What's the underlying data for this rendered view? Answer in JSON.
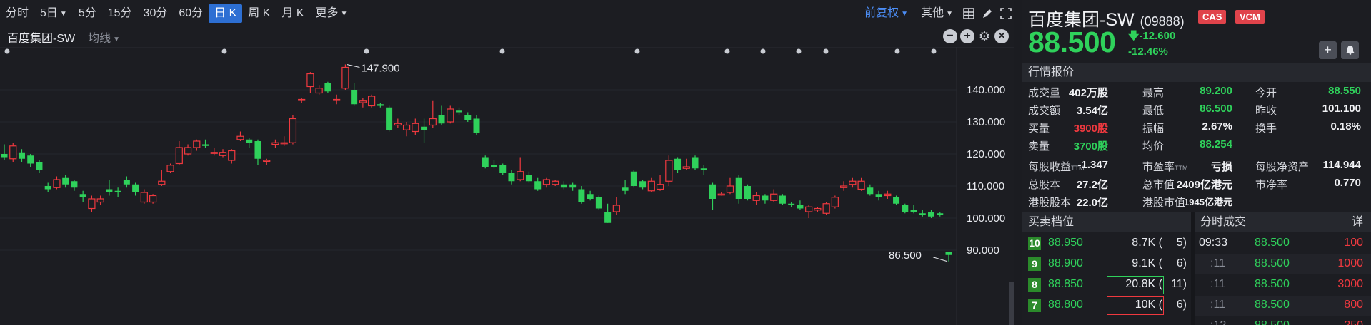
{
  "toolbar": {
    "periods": [
      "分时",
      "5日",
      "5分",
      "15分",
      "30分",
      "60分",
      "日 K",
      "周 K",
      "月 K",
      "更多"
    ],
    "active_period": "日 K",
    "adjust": "前复权",
    "other": "其他"
  },
  "chart_header": {
    "name": "百度集团-SW",
    "ma": "均线"
  },
  "chart_data": {
    "type": "candlestick",
    "y_ticks": [
      "140.000",
      "130.000",
      "120.000",
      "110.000",
      "100.000",
      "90.000"
    ],
    "ylim": [
      86,
      150
    ],
    "high_label": "147.900",
    "low_label": "86.500",
    "up_color": "#f0393f",
    "down_color": "#2fd15b",
    "candles": [
      {
        "o": 120.0,
        "c": 119.0,
        "h": 123.0,
        "l": 118.0
      },
      {
        "o": 118.5,
        "c": 122.5,
        "h": 123.5,
        "l": 117.5
      },
      {
        "o": 120.5,
        "c": 118.5,
        "h": 121.5,
        "l": 117.5
      },
      {
        "o": 119.5,
        "c": 117.0,
        "h": 120.0,
        "l": 116.0
      },
      {
        "o": 117.5,
        "c": 115.0,
        "h": 118.0,
        "l": 114.0
      },
      {
        "o": 110.0,
        "c": 109.0,
        "h": 111.0,
        "l": 108.0
      },
      {
        "o": 109.5,
        "c": 112.0,
        "h": 113.0,
        "l": 109.0
      },
      {
        "o": 112.5,
        "c": 110.5,
        "h": 113.5,
        "l": 109.5
      },
      {
        "o": 111.5,
        "c": 109.5,
        "h": 112.0,
        "l": 108.5
      },
      {
        "o": 107.5,
        "c": 106.5,
        "h": 108.5,
        "l": 105.0
      },
      {
        "o": 103.0,
        "c": 106.0,
        "h": 107.0,
        "l": 102.0
      },
      {
        "o": 105.0,
        "c": 106.0,
        "h": 107.0,
        "l": 104.0
      },
      {
        "o": 109.0,
        "c": 108.0,
        "h": 112.0,
        "l": 107.0
      },
      {
        "o": 108.5,
        "c": 108.0,
        "h": 109.5,
        "l": 106.5
      },
      {
        "o": 112.0,
        "c": 110.5,
        "h": 113.0,
        "l": 109.5
      },
      {
        "o": 110.5,
        "c": 108.0,
        "h": 111.0,
        "l": 107.0
      },
      {
        "o": 105.0,
        "c": 108.0,
        "h": 109.0,
        "l": 104.5
      },
      {
        "o": 105.0,
        "c": 107.0,
        "h": 107.5,
        "l": 104.5
      },
      {
        "o": 110.5,
        "c": 111.5,
        "h": 115.0,
        "l": 110.0
      },
      {
        "o": 114.5,
        "c": 116.5,
        "h": 117.0,
        "l": 114.0
      },
      {
        "o": 117.0,
        "c": 122.0,
        "h": 124.0,
        "l": 116.5
      },
      {
        "o": 120.0,
        "c": 122.0,
        "h": 123.0,
        "l": 119.5
      },
      {
        "o": 122.0,
        "c": 124.0,
        "h": 124.5,
        "l": 121.0
      },
      {
        "o": 123.0,
        "c": 122.5,
        "h": 124.5,
        "l": 122.0
      },
      {
        "o": 120.5,
        "c": 120.5,
        "h": 122.0,
        "l": 119.5
      },
      {
        "o": 119.5,
        "c": 120.5,
        "h": 121.5,
        "l": 119.0
      },
      {
        "o": 118.0,
        "c": 121.0,
        "h": 121.5,
        "l": 117.0
      },
      {
        "o": 124.5,
        "c": 125.5,
        "h": 127.0,
        "l": 124.0
      },
      {
        "o": 124.5,
        "c": 123.5,
        "h": 125.0,
        "l": 122.0
      },
      {
        "o": 124.0,
        "c": 118.5,
        "h": 124.5,
        "l": 116.5
      },
      {
        "o": 118.0,
        "c": 118.0,
        "h": 118.5,
        "l": 116.5
      },
      {
        "o": 123.0,
        "c": 123.5,
        "h": 124.5,
        "l": 122.0
      },
      {
        "o": 123.5,
        "c": 123.5,
        "h": 125.5,
        "l": 122.5
      },
      {
        "o": 123.5,
        "c": 131.0,
        "h": 132.0,
        "l": 123.0
      },
      {
        "o": 137.0,
        "c": 137.0,
        "h": 137.5,
        "l": 136.0
      },
      {
        "o": 141.0,
        "c": 145.0,
        "h": 145.5,
        "l": 139.0
      },
      {
        "o": 139.0,
        "c": 140.5,
        "h": 141.5,
        "l": 138.5
      },
      {
        "o": 142.0,
        "c": 139.5,
        "h": 142.5,
        "l": 139.0
      },
      {
        "o": 137.0,
        "c": 137.0,
        "h": 138.5,
        "l": 135.5
      },
      {
        "o": 140.5,
        "c": 147.0,
        "h": 147.9,
        "l": 140.0
      },
      {
        "o": 140.0,
        "c": 135.5,
        "h": 142.0,
        "l": 135.0
      },
      {
        "o": 136.0,
        "c": 136.5,
        "h": 137.5,
        "l": 134.5
      },
      {
        "o": 135.0,
        "c": 138.0,
        "h": 138.5,
        "l": 134.5
      },
      {
        "o": 135.5,
        "c": 135.0,
        "h": 136.0,
        "l": 134.5
      },
      {
        "o": 134.5,
        "c": 127.5,
        "h": 135.0,
        "l": 127.0
      },
      {
        "o": 129.0,
        "c": 129.5,
        "h": 131.0,
        "l": 128.0
      },
      {
        "o": 127.5,
        "c": 129.0,
        "h": 130.0,
        "l": 125.5
      },
      {
        "o": 127.0,
        "c": 129.5,
        "h": 131.0,
        "l": 126.0
      },
      {
        "o": 128.5,
        "c": 127.5,
        "h": 131.0,
        "l": 123.5
      },
      {
        "o": 129.0,
        "c": 131.0,
        "h": 136.5,
        "l": 128.0
      },
      {
        "o": 132.0,
        "c": 129.5,
        "h": 135.0,
        "l": 129.0
      },
      {
        "o": 130.0,
        "c": 134.0,
        "h": 135.0,
        "l": 129.5
      },
      {
        "o": 133.5,
        "c": 133.0,
        "h": 134.5,
        "l": 132.0
      },
      {
        "o": 132.0,
        "c": 130.5,
        "h": 133.0,
        "l": 130.0
      },
      {
        "o": 131.0,
        "c": 126.5,
        "h": 132.0,
        "l": 126.0
      },
      {
        "o": 119.0,
        "c": 116.0,
        "h": 119.5,
        "l": 115.5
      },
      {
        "o": 116.5,
        "c": 116.0,
        "h": 118.0,
        "l": 115.5
      },
      {
        "o": 116.5,
        "c": 114.0,
        "h": 117.0,
        "l": 113.5
      },
      {
        "o": 114.0,
        "c": 111.5,
        "h": 115.0,
        "l": 110.5
      },
      {
        "o": 112.0,
        "c": 114.5,
        "h": 119.0,
        "l": 111.5
      },
      {
        "o": 113.5,
        "c": 111.5,
        "h": 114.5,
        "l": 111.0
      },
      {
        "o": 111.5,
        "c": 109.0,
        "h": 112.5,
        "l": 108.5
      },
      {
        "o": 110.5,
        "c": 112.0,
        "h": 112.5,
        "l": 109.5
      },
      {
        "o": 110.5,
        "c": 111.5,
        "h": 112.0,
        "l": 110.0
      },
      {
        "o": 110.5,
        "c": 109.5,
        "h": 111.5,
        "l": 109.0
      },
      {
        "o": 110.5,
        "c": 109.5,
        "h": 111.0,
        "l": 108.5
      },
      {
        "o": 109.0,
        "c": 105.0,
        "h": 110.0,
        "l": 104.5
      },
      {
        "o": 107.5,
        "c": 106.0,
        "h": 108.5,
        "l": 105.5
      },
      {
        "o": 106.5,
        "c": 103.0,
        "h": 107.0,
        "l": 102.5
      },
      {
        "o": 102.0,
        "c": 98.5,
        "h": 104.5,
        "l": 98.5
      },
      {
        "o": 102.0,
        "c": 104.0,
        "h": 106.5,
        "l": 101.0
      },
      {
        "o": 109.5,
        "c": 108.5,
        "h": 112.0,
        "l": 107.5
      },
      {
        "o": 114.5,
        "c": 110.0,
        "h": 115.0,
        "l": 109.5
      },
      {
        "o": 111.5,
        "c": 109.5,
        "h": 112.0,
        "l": 109.0
      },
      {
        "o": 108.5,
        "c": 111.5,
        "h": 112.5,
        "l": 108.0
      },
      {
        "o": 109.0,
        "c": 110.5,
        "h": 113.5,
        "l": 108.5
      },
      {
        "o": 111.5,
        "c": 118.0,
        "h": 119.5,
        "l": 110.0
      },
      {
        "o": 118.5,
        "c": 115.0,
        "h": 119.0,
        "l": 114.0
      },
      {
        "o": 115.5,
        "c": 116.0,
        "h": 118.5,
        "l": 115.0
      },
      {
        "o": 119.0,
        "c": 115.5,
        "h": 119.5,
        "l": 115.0
      },
      {
        "o": 115.5,
        "c": 115.0,
        "h": 116.5,
        "l": 113.5
      },
      {
        "o": 110.5,
        "c": 106.0,
        "h": 111.0,
        "l": 102.5
      },
      {
        "o": 107.5,
        "c": 107.5,
        "h": 108.0,
        "l": 107.0
      },
      {
        "o": 108.0,
        "c": 110.0,
        "h": 112.5,
        "l": 107.5
      },
      {
        "o": 112.5,
        "c": 106.0,
        "h": 113.5,
        "l": 104.5
      },
      {
        "o": 110.0,
        "c": 106.0,
        "h": 110.5,
        "l": 105.5
      },
      {
        "o": 105.5,
        "c": 107.0,
        "h": 108.0,
        "l": 104.0
      },
      {
        "o": 107.0,
        "c": 105.5,
        "h": 107.5,
        "l": 104.5
      },
      {
        "o": 105.5,
        "c": 107.5,
        "h": 109.0,
        "l": 105.0
      },
      {
        "o": 107.0,
        "c": 104.5,
        "h": 107.5,
        "l": 104.0
      },
      {
        "o": 104.5,
        "c": 104.0,
        "h": 105.0,
        "l": 103.5
      },
      {
        "o": 104.0,
        "c": 103.0,
        "h": 105.5,
        "l": 102.5
      },
      {
        "o": 102.0,
        "c": 103.5,
        "h": 104.0,
        "l": 100.0
      },
      {
        "o": 102.5,
        "c": 103.0,
        "h": 103.5,
        "l": 102.0
      },
      {
        "o": 101.5,
        "c": 104.5,
        "h": 105.0,
        "l": 101.0
      },
      {
        "o": 103.5,
        "c": 106.5,
        "h": 107.0,
        "l": 103.0
      },
      {
        "o": 109.5,
        "c": 110.0,
        "h": 111.5,
        "l": 108.5
      },
      {
        "o": 110.5,
        "c": 111.5,
        "h": 112.5,
        "l": 109.5
      },
      {
        "o": 109.0,
        "c": 111.5,
        "h": 112.5,
        "l": 108.5
      },
      {
        "o": 109.5,
        "c": 107.5,
        "h": 110.5,
        "l": 107.0
      },
      {
        "o": 107.5,
        "c": 106.5,
        "h": 108.5,
        "l": 105.5
      },
      {
        "o": 107.0,
        "c": 107.5,
        "h": 108.5,
        "l": 106.0
      },
      {
        "o": 106.5,
        "c": 104.5,
        "h": 107.0,
        "l": 104.0
      },
      {
        "o": 104.0,
        "c": 102.0,
        "h": 104.5,
        "l": 101.5
      },
      {
        "o": 102.5,
        "c": 102.0,
        "h": 104.0,
        "l": 101.5
      },
      {
        "o": 101.5,
        "c": 101.0,
        "h": 102.5,
        "l": 100.5
      },
      {
        "o": 102.0,
        "c": 100.5,
        "h": 102.5,
        "l": 100.0
      },
      {
        "o": 101.5,
        "c": 101.0,
        "h": 102.0,
        "l": 100.5
      },
      {
        "o": 89.5,
        "c": 88.5,
        "h": 89.2,
        "l": 86.5
      }
    ]
  },
  "quote": {
    "name": "百度集团-SW",
    "code": "(09888)",
    "badges": [
      "CAS",
      "VCM"
    ],
    "price": "88.500",
    "change": "-12.600",
    "change_pct": "-12.46%",
    "section_title": "行情报价",
    "rows": [
      [
        [
          "成交量",
          "402万股",
          "w"
        ],
        [
          "最高",
          "89.200",
          "g"
        ],
        [
          "今开",
          "88.550",
          "g"
        ]
      ],
      [
        [
          "成交额",
          "3.54亿",
          "w"
        ],
        [
          "最低",
          "86.500",
          "g"
        ],
        [
          "昨收",
          "101.100",
          "w"
        ]
      ],
      [
        [
          "买量",
          "3900股",
          "r"
        ],
        [
          "振幅",
          "2.67%",
          "w"
        ],
        [
          "换手",
          "0.18%",
          "w"
        ]
      ],
      [
        [
          "卖量",
          "3700股",
          "g"
        ],
        [
          "均价",
          "88.254",
          "g"
        ],
        [
          "",
          "",
          " "
        ]
      ]
    ],
    "rows2": [
      [
        [
          "每股收益",
          "TTM",
          "-1.347"
        ],
        [
          "市盈率",
          "TTM",
          "亏损"
        ],
        [
          "每股净资产",
          "",
          "114.944"
        ]
      ],
      [
        [
          "总股本",
          "",
          "27.2亿"
        ],
        [
          "总市值",
          "",
          "2409亿港元"
        ],
        [
          "市净率",
          "",
          "0.770"
        ]
      ],
      [
        [
          "港股股本",
          "",
          "22.0亿"
        ],
        [
          "港股市值",
          "",
          "1945亿港元"
        ],
        [
          "",
          "",
          ""
        ]
      ]
    ]
  },
  "orderbook": {
    "title": "买卖档位",
    "rows": [
      {
        "level": "10",
        "price": "88.950",
        "vol": "8.7K",
        "cnt": "5)",
        "box": ""
      },
      {
        "level": "9",
        "price": "88.900",
        "vol": "9.1K",
        "cnt": "6)",
        "box": ""
      },
      {
        "level": "8",
        "price": "88.850",
        "vol": "20.8K",
        "cnt": "11)",
        "box": "green"
      },
      {
        "level": "7",
        "price": "88.800",
        "vol": "10K",
        "cnt": "6)",
        "box": "red"
      }
    ]
  },
  "trades": {
    "title": "分时成交",
    "detail": "详",
    "rows": [
      {
        "time": "09:33",
        "price": "88.500",
        "vol": "100"
      },
      {
        "time": ":11",
        "price": "88.500",
        "vol": "1000"
      },
      {
        "time": ":11",
        "price": "88.500",
        "vol": "3000"
      },
      {
        "time": ":11",
        "price": "88.500",
        "vol": "800"
      },
      {
        "time": ":12",
        "price": "88.500",
        "vol": "250"
      }
    ]
  }
}
